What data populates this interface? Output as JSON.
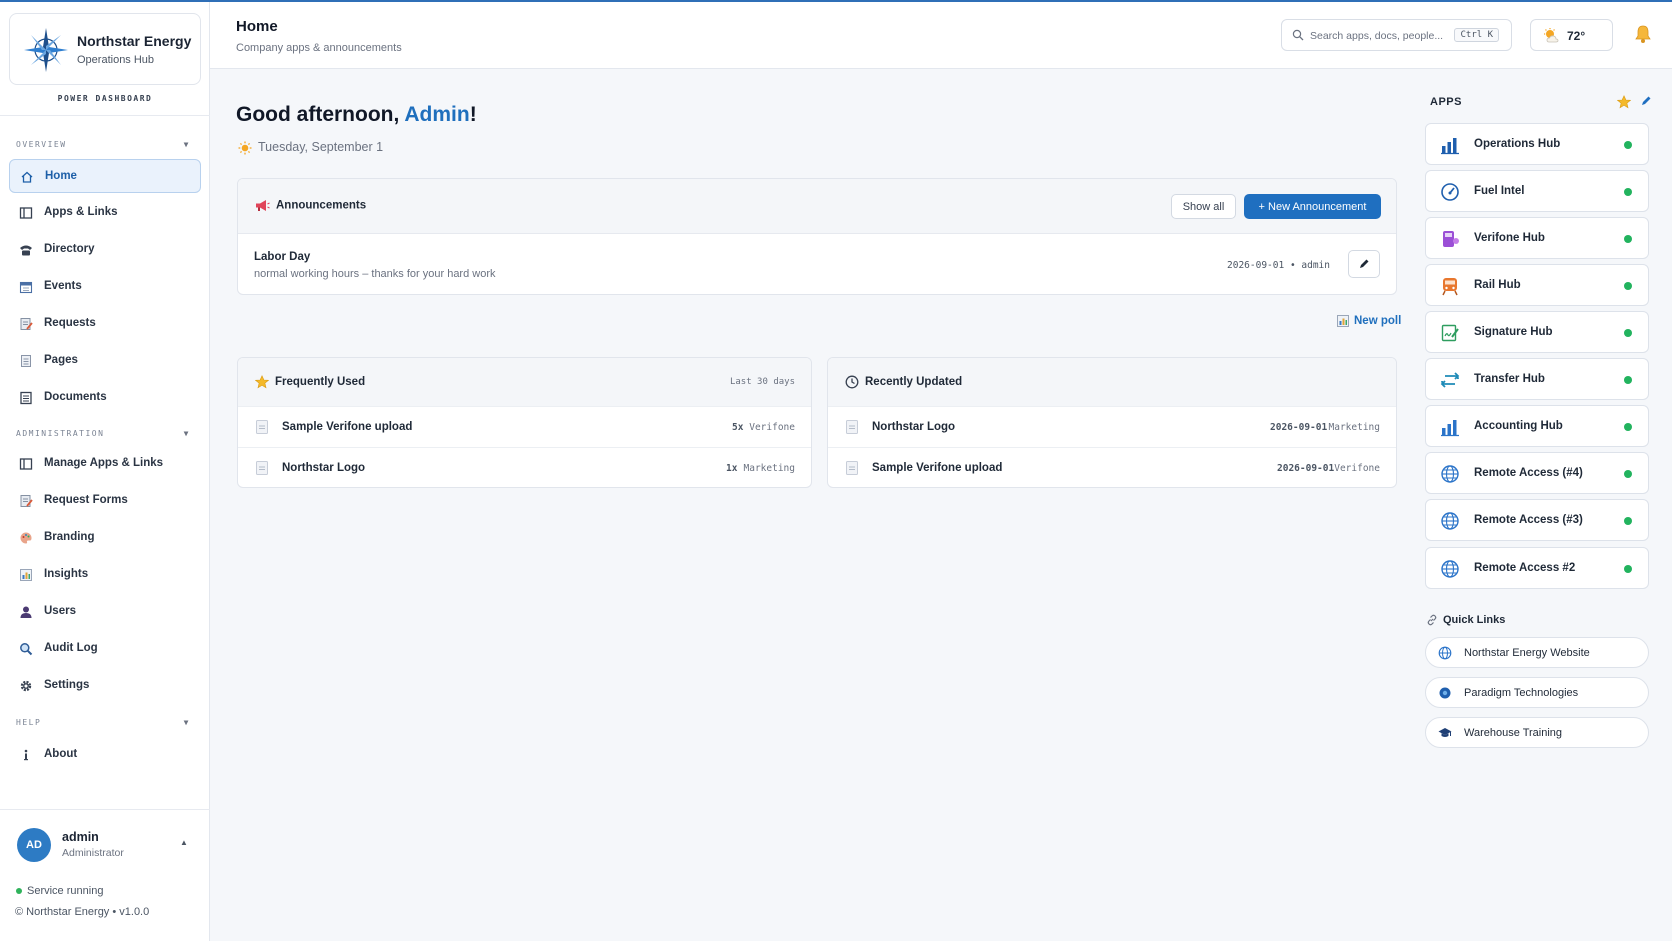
{
  "sidebar": {
    "brand_name": "Northstar Energy",
    "brand_sub": "Operations Hub",
    "dashboard_label": "POWER DASHBOARD",
    "sections": {
      "overview": "OVERVIEW",
      "administration": "ADMINISTRATION",
      "help": "HELP"
    },
    "overview_items": [
      {
        "label": "Home",
        "icon": "home-icon"
      },
      {
        "label": "Apps & Links",
        "icon": "book-icon"
      },
      {
        "label": "Directory",
        "icon": "phone-icon"
      },
      {
        "label": "Events",
        "icon": "calendar-icon"
      },
      {
        "label": "Requests",
        "icon": "request-icon"
      },
      {
        "label": "Pages",
        "icon": "page-icon"
      },
      {
        "label": "Documents",
        "icon": "documents-icon"
      }
    ],
    "admin_items": [
      {
        "label": "Manage Apps & Links",
        "icon": "book-icon"
      },
      {
        "label": "Request Forms",
        "icon": "form-icon"
      },
      {
        "label": "Branding",
        "icon": "palette-icon"
      },
      {
        "label": "Insights",
        "icon": "chart-icon"
      },
      {
        "label": "Users",
        "icon": "user-icon"
      },
      {
        "label": "Audit Log",
        "icon": "magnifier-icon"
      },
      {
        "label": "Settings",
        "icon": "gear-icon"
      }
    ],
    "help_items": [
      {
        "label": "About",
        "icon": "info-icon"
      }
    ],
    "user": {
      "initials": "AD",
      "name": "admin",
      "role": "Administrator"
    },
    "status": "Service running",
    "footer": "© Northstar Energy  •  v1.0.0"
  },
  "header": {
    "title": "Home",
    "subtitle": "Company apps & announcements",
    "search_placeholder": "Search apps, docs, people...",
    "search_shortcut": "Ctrl K",
    "weather_temp": "72°"
  },
  "main": {
    "greeting_prefix": "Good afternoon, ",
    "greeting_name": "Admin",
    "greeting_suffix": "!",
    "date": "Tuesday, September 1",
    "announcements": {
      "title": "Announcements",
      "show_all": "Show all",
      "new_button": "+ New Announcement",
      "items": [
        {
          "title": "Labor Day",
          "body": "normal working hours – thanks for your hard work",
          "date": "2026-09-01",
          "author": "admin"
        }
      ]
    },
    "new_poll": "New poll",
    "frequently_used": {
      "title": "Frequently Used",
      "range": "Last 30 days",
      "rows": [
        {
          "name": "Sample Verifone upload",
          "count": "5x",
          "tag": "Verifone"
        },
        {
          "name": "Northstar Logo",
          "count": "1x",
          "tag": "Marketing"
        }
      ]
    },
    "recently_updated": {
      "title": "Recently Updated",
      "rows": [
        {
          "name": "Northstar Logo",
          "date": "2026-09-01",
          "tag": "Marketing"
        },
        {
          "name": "Sample Verifone upload",
          "date": "2026-09-01",
          "tag": "Verifone"
        }
      ]
    }
  },
  "apps_panel": {
    "title": "APPS",
    "apps": [
      {
        "name": "Operations Hub",
        "icon": "bar-chart-icon",
        "status": "online"
      },
      {
        "name": "Fuel Intel",
        "icon": "gauge-icon",
        "status": "online"
      },
      {
        "name": "Verifone Hub",
        "icon": "terminal-icon",
        "status": "online"
      },
      {
        "name": "Rail Hub",
        "icon": "train-icon",
        "status": "online"
      },
      {
        "name": "Signature Hub",
        "icon": "signature-icon",
        "status": "online"
      },
      {
        "name": "Transfer Hub",
        "icon": "transfer-icon",
        "status": "online"
      },
      {
        "name": "Accounting Hub",
        "icon": "bar-chart-icon",
        "status": "online"
      },
      {
        "name": "Remote Access (#4)",
        "icon": "globe-icon",
        "status": "online"
      },
      {
        "name": "Remote Access (#3)",
        "icon": "globe-icon",
        "status": "online"
      },
      {
        "name": "Remote Access #2",
        "icon": "globe-icon",
        "status": "online"
      }
    ],
    "quick_links_title": "Quick Links",
    "quick_links": [
      {
        "name": "Northstar Energy Website",
        "icon": "globe-icon"
      },
      {
        "name": "Paradigm Technologies",
        "icon": "disc-icon"
      },
      {
        "name": "Warehouse Training",
        "icon": "graduation-cap-icon"
      }
    ]
  },
  "colors": {
    "accent": "#1f6fc0",
    "status_online": "#22b35e",
    "active_bg": "#eaf2fc"
  }
}
